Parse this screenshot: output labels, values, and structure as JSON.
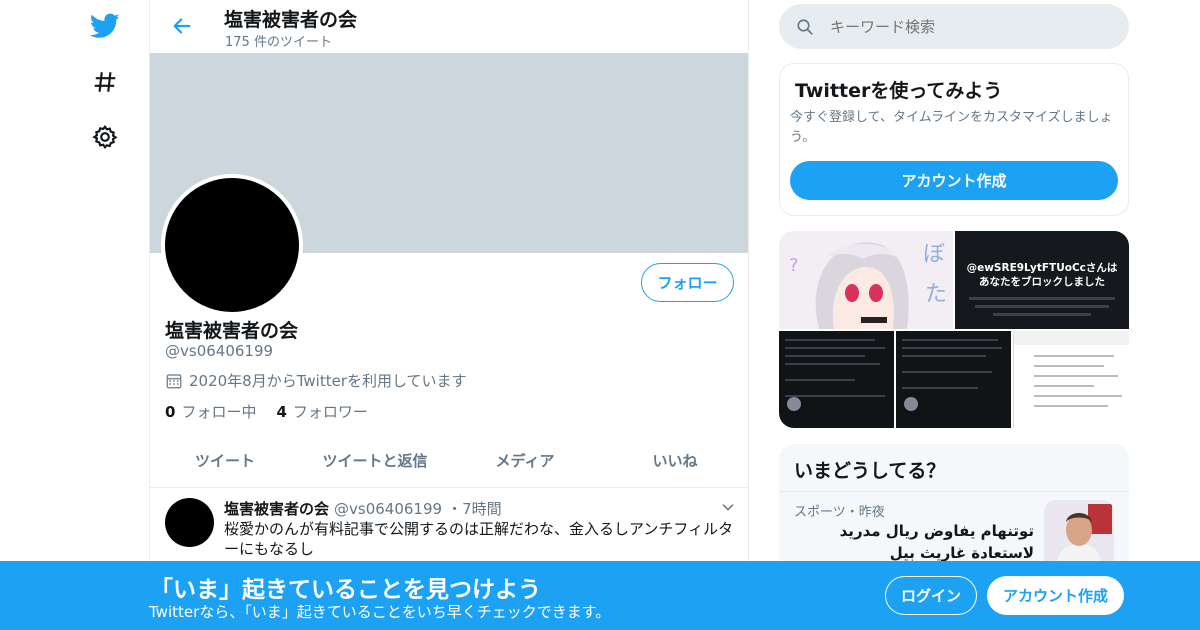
{
  "colors": {
    "accent": "#1da1f2",
    "banner": "#ccd6dd",
    "muted": "#657786",
    "border": "#e6ecf0"
  },
  "nav": {
    "icons": [
      "twitter-logo-icon",
      "hashtag-icon",
      "gear-icon"
    ]
  },
  "header": {
    "title": "塩害被害者の会",
    "tweet_count": "175 件のツイート"
  },
  "profile": {
    "follow_label": "フォロー",
    "name": "塩害被害者の会",
    "handle": "@vs06406199",
    "joined": "2020年8月からTwitterを利用しています",
    "following_count": "0",
    "following_label": "フォロー中",
    "followers_count": "4",
    "followers_label": "フォロワー"
  },
  "tabs": [
    {
      "label": "ツイート"
    },
    {
      "label": "ツイートと返信"
    },
    {
      "label": "メディア"
    },
    {
      "label": "いいね"
    }
  ],
  "tweet": {
    "name": "塩害被害者の会",
    "handle": "@vs06406199",
    "separator": "・",
    "time": "7時間",
    "text": "桜愛かのんが有料記事で公開するのは正解だわな、金入るしアンチフィルターにもなるし"
  },
  "search": {
    "placeholder": "キーワード検索"
  },
  "signup_card": {
    "title": "Twitterを使ってみよう",
    "description": "今すぐ登録して、タイムラインをカスタマイズしましょう。",
    "button": "アカウント作成"
  },
  "media": {
    "block_title_line1": "@ewSRE9LytFTUoCcさんは",
    "block_title_line2": "あなたをブロックしました"
  },
  "trends": {
    "title": "いまどうしてる？",
    "item_meta": "スポーツ・昨夜",
    "item_text_line1": "توتنهام يفاوض ريال مدريد",
    "item_text_line2": "لاستعادة غاريث بيل"
  },
  "bottom_bar": {
    "title": "「いま」起きていることを見つけよう",
    "subtitle": "Twitterなら、「いま」起きていることをいち早くチェックできます。",
    "login": "ログイン",
    "signup": "アカウント作成"
  }
}
